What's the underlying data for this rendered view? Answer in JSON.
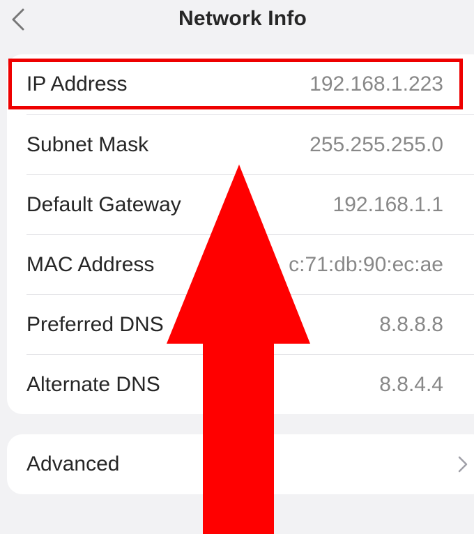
{
  "header": {
    "title": "Network Info",
    "back_icon": "chevron-left-icon"
  },
  "network": {
    "rows": [
      {
        "label": "IP Address",
        "value": "192.168.1.223"
      },
      {
        "label": "Subnet Mask",
        "value": "255.255.255.0"
      },
      {
        "label": "Default Gateway",
        "value": "192.168.1.1"
      },
      {
        "label": "MAC Address",
        "value": "c:71:db:90:ec:ae"
      },
      {
        "label": "Preferred DNS",
        "value": "8.8.8.8"
      },
      {
        "label": "Alternate DNS",
        "value": "8.8.4.4"
      }
    ]
  },
  "advanced": {
    "label": "Advanced",
    "icon": "chevron-right-icon"
  },
  "annotation": {
    "highlight_color": "#ee0000",
    "arrow_color": "#ff0000",
    "arrow_direction": "up"
  }
}
